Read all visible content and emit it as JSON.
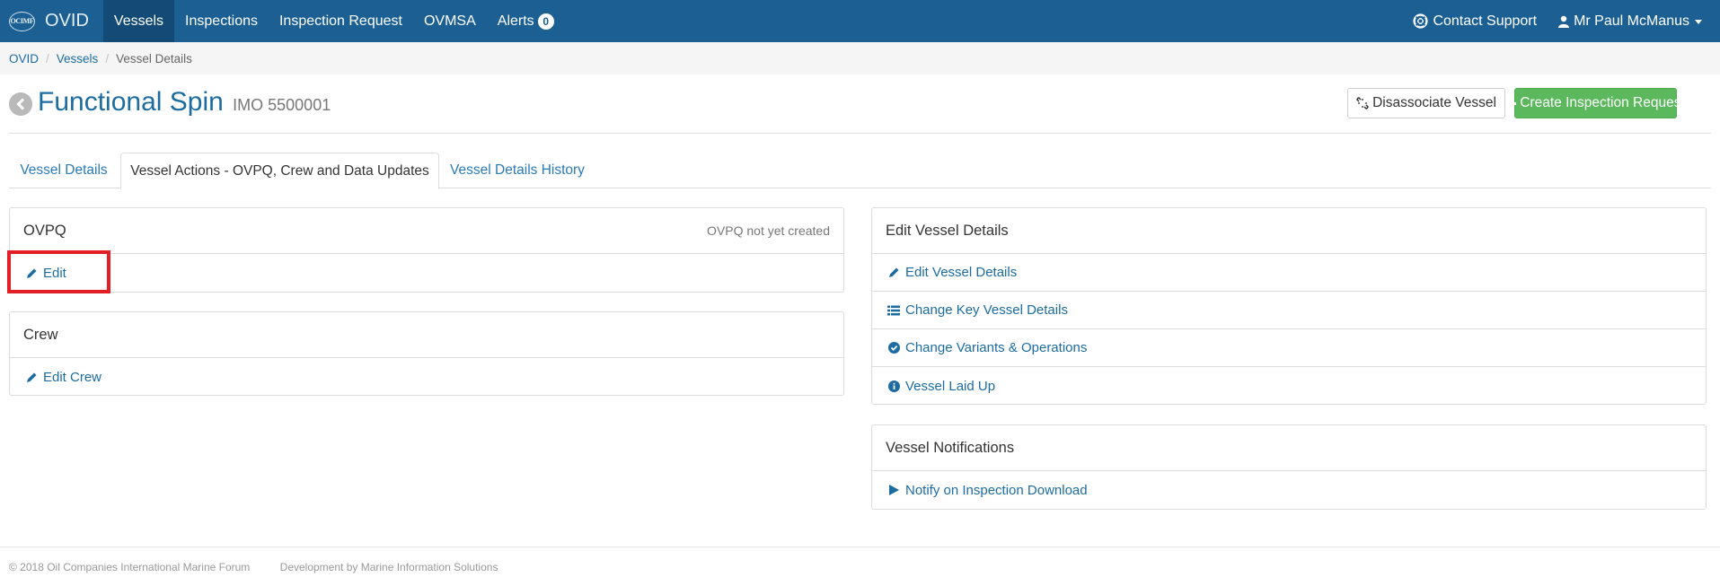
{
  "navbar": {
    "brand_logo": "OCIMF",
    "brand": "OVID",
    "items": [
      {
        "label": "Vessels",
        "active": true
      },
      {
        "label": "Inspections"
      },
      {
        "label": "Inspection Request"
      },
      {
        "label": "OVMSA"
      },
      {
        "label": "Alerts",
        "badge": "0"
      }
    ],
    "contact_support": "Contact Support",
    "user_name": "Mr Paul McManus",
    "colors": {
      "bar": "#1b5f93",
      "active": "#134b76"
    }
  },
  "breadcrumb": [
    "OVID",
    "Vessels",
    "Vessel Details"
  ],
  "page": {
    "title": "Functional Spin",
    "subtitle": "IMO 5500001",
    "disassociate_label": "Disassociate Vessel",
    "create_request_label": "Create Inspection Request"
  },
  "tabs": [
    {
      "label": "Vessel Details"
    },
    {
      "label": "Vessel Actions - OVPQ, Crew and Data Updates",
      "active": true
    },
    {
      "label": "Vessel Details History"
    }
  ],
  "panels": {
    "ovpq": {
      "title": "OVPQ",
      "status": "OVPQ not yet created",
      "edit_label": "Edit"
    },
    "crew": {
      "title": "Crew",
      "edit_label": "Edit Crew"
    },
    "edit_vessel": {
      "title": "Edit Vessel Details",
      "items": [
        {
          "label": "Edit Vessel Details",
          "icon": "pencil-icon"
        },
        {
          "label": "Change Key Vessel Details",
          "icon": "list-icon"
        },
        {
          "label": "Change Variants & Operations",
          "icon": "check-circle-icon"
        },
        {
          "label": "Vessel Laid Up",
          "icon": "info-circle-icon"
        }
      ]
    },
    "notifications": {
      "title": "Vessel Notifications",
      "items": [
        {
          "label": "Notify on Inspection Download",
          "icon": "play-icon"
        }
      ]
    }
  },
  "footer": {
    "copyright": "© 2018 Oil Companies International Marine Forum",
    "developer": "Development by Marine Information Solutions"
  },
  "highlight_color": "#e31e24"
}
